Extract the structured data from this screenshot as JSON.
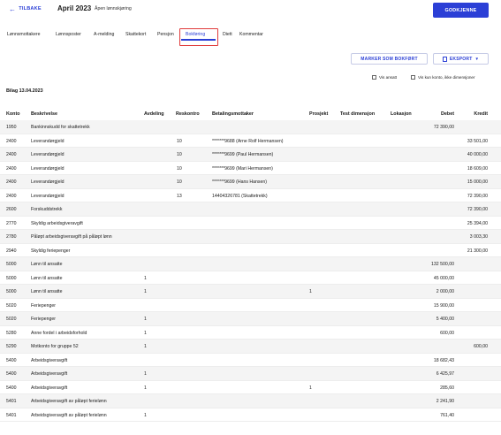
{
  "header": {
    "back_label": "TILBAKE",
    "title": "April 2023",
    "subtitle": "Åpen lønnskjøring",
    "approve_label": "GODKJENNE"
  },
  "tabs": [
    {
      "label": "Lønnsmottakere"
    },
    {
      "label": "Lønnsposter"
    },
    {
      "label": "A-melding"
    },
    {
      "label": "Skattekort"
    },
    {
      "label": "Pensjon"
    },
    {
      "label": "Bokføring",
      "active": true
    },
    {
      "label": "Diett"
    },
    {
      "label": "Kommentar"
    }
  ],
  "actions": {
    "mark_posted_label": "MARKER SOM BOKFØRT",
    "export_label": "EKSPORT"
  },
  "filters": {
    "show_employee": "Vis ansatt",
    "show_only_account": "Vis kun konto, ikke dimensjoner"
  },
  "voucher_label": "Bilag 13.04.2023",
  "columns": {
    "konto": "Konto",
    "beskrivelse": "Beskrivelse",
    "avdeling": "Avdeling",
    "reskontro": "Reskontro",
    "betalingsmottaker": "Betalingsmottaker",
    "prosjekt": "Prosjekt",
    "test_dimensjon": "Test dimensjon",
    "lokasjon": "Lokasjon",
    "debet": "Debet",
    "kredit": "Kredit"
  },
  "rows": [
    {
      "konto": "1950",
      "besk": "Bankinnskudd for skattetrekk",
      "avd": "",
      "resk": "",
      "betal": "",
      "proj": "",
      "debet": "72 390,00",
      "kredit": ""
    },
    {
      "konto": "2400",
      "besk": "Leverandørgjeld",
      "avd": "",
      "resk": "10",
      "betal": "*******9688 (Arne Rolf Hermansen)",
      "proj": "",
      "debet": "",
      "kredit": "33 501,00"
    },
    {
      "konto": "2400",
      "besk": "Leverandørgjeld",
      "avd": "",
      "resk": "10",
      "betal": "*******9699 (Paul Hermansen)",
      "proj": "",
      "debet": "",
      "kredit": "40 000,00"
    },
    {
      "konto": "2400",
      "besk": "Leverandørgjeld",
      "avd": "",
      "resk": "10",
      "betal": "*******9699 (Mari Hermansen)",
      "proj": "",
      "debet": "",
      "kredit": "18 609,00"
    },
    {
      "konto": "2400",
      "besk": "Leverandørgjeld",
      "avd": "",
      "resk": "10",
      "betal": "*******9699 (Hans Hansen)",
      "proj": "",
      "debet": "",
      "kredit": "15 000,00"
    },
    {
      "konto": "2400",
      "besk": "Leverandørgjeld",
      "avd": "",
      "resk": "13",
      "betal": "14404326781 (Skattetrekk)",
      "proj": "",
      "debet": "",
      "kredit": "72 390,00"
    },
    {
      "konto": "2600",
      "besk": "Forskuddstrekk",
      "avd": "",
      "resk": "",
      "betal": "",
      "proj": "",
      "debet": "",
      "kredit": "72 390,00"
    },
    {
      "konto": "2770",
      "besk": "Skyldig arbeidsgiveravgift",
      "avd": "",
      "resk": "",
      "betal": "",
      "proj": "",
      "debet": "",
      "kredit": "25 394,00"
    },
    {
      "konto": "2780",
      "besk": "Påløpt arbeidsgiveravgift på påløpt lønn",
      "avd": "",
      "resk": "",
      "betal": "",
      "proj": "",
      "debet": "",
      "kredit": "3 003,30"
    },
    {
      "konto": "2940",
      "besk": "Skyldig feriepenger",
      "avd": "",
      "resk": "",
      "betal": "",
      "proj": "",
      "debet": "",
      "kredit": "21 300,00"
    },
    {
      "konto": "5000",
      "besk": "Lønn til ansatte",
      "avd": "",
      "resk": "",
      "betal": "",
      "proj": "",
      "debet": "132 500,00",
      "kredit": ""
    },
    {
      "konto": "5000",
      "besk": "Lønn til ansatte",
      "avd": "1",
      "resk": "",
      "betal": "",
      "proj": "",
      "debet": "45 000,00",
      "kredit": ""
    },
    {
      "konto": "5000",
      "besk": "Lønn til ansatte",
      "avd": "1",
      "resk": "",
      "betal": "",
      "proj": "1",
      "debet": "2 000,00",
      "kredit": ""
    },
    {
      "konto": "5020",
      "besk": "Feriepenger",
      "avd": "",
      "resk": "",
      "betal": "",
      "proj": "",
      "debet": "15 900,00",
      "kredit": ""
    },
    {
      "konto": "5020",
      "besk": "Feriepenger",
      "avd": "1",
      "resk": "",
      "betal": "",
      "proj": "",
      "debet": "5 400,00",
      "kredit": ""
    },
    {
      "konto": "5280",
      "besk": "Anne fordel i arbeidsforhold",
      "avd": "1",
      "resk": "",
      "betal": "",
      "proj": "",
      "debet": "600,00",
      "kredit": ""
    },
    {
      "konto": "5290",
      "besk": "Motkonto for gruppe 52",
      "avd": "1",
      "resk": "",
      "betal": "",
      "proj": "",
      "debet": "",
      "kredit": "600,00"
    },
    {
      "konto": "5400",
      "besk": "Arbeidsgiveravgift",
      "avd": "",
      "resk": "",
      "betal": "",
      "proj": "",
      "debet": "18 682,43",
      "kredit": ""
    },
    {
      "konto": "5400",
      "besk": "Arbeidsgiveravgift",
      "avd": "1",
      "resk": "",
      "betal": "",
      "proj": "",
      "debet": "6 425,97",
      "kredit": ""
    },
    {
      "konto": "5400",
      "besk": "Arbeidsgiveravgift",
      "avd": "1",
      "resk": "",
      "betal": "",
      "proj": "1",
      "debet": "285,60",
      "kredit": ""
    },
    {
      "konto": "5401",
      "besk": "Arbeidsgiveravgift av påløpt ferielønn",
      "avd": "",
      "resk": "",
      "betal": "",
      "proj": "",
      "debet": "2 241,90",
      "kredit": ""
    },
    {
      "konto": "5401",
      "besk": "Arbeidsgiveravgift av påløpt ferielønn",
      "avd": "1",
      "resk": "",
      "betal": "",
      "proj": "",
      "debet": "761,40",
      "kredit": ""
    }
  ]
}
